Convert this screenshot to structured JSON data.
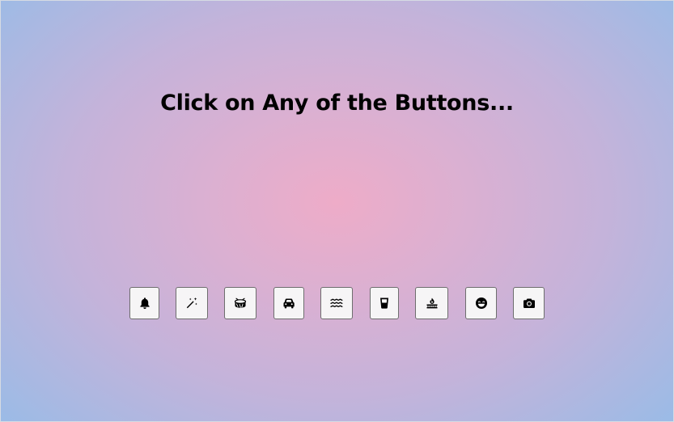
{
  "heading": "Click on Any of the Buttons...",
  "buttons": [
    {
      "icon": "bell-icon"
    },
    {
      "icon": "magic-wand-icon"
    },
    {
      "icon": "drum-icon"
    },
    {
      "icon": "car-icon"
    },
    {
      "icon": "water-waves-icon"
    },
    {
      "icon": "glass-icon"
    },
    {
      "icon": "fire-burner-icon"
    },
    {
      "icon": "laughing-face-icon"
    },
    {
      "icon": "camera-icon"
    }
  ]
}
